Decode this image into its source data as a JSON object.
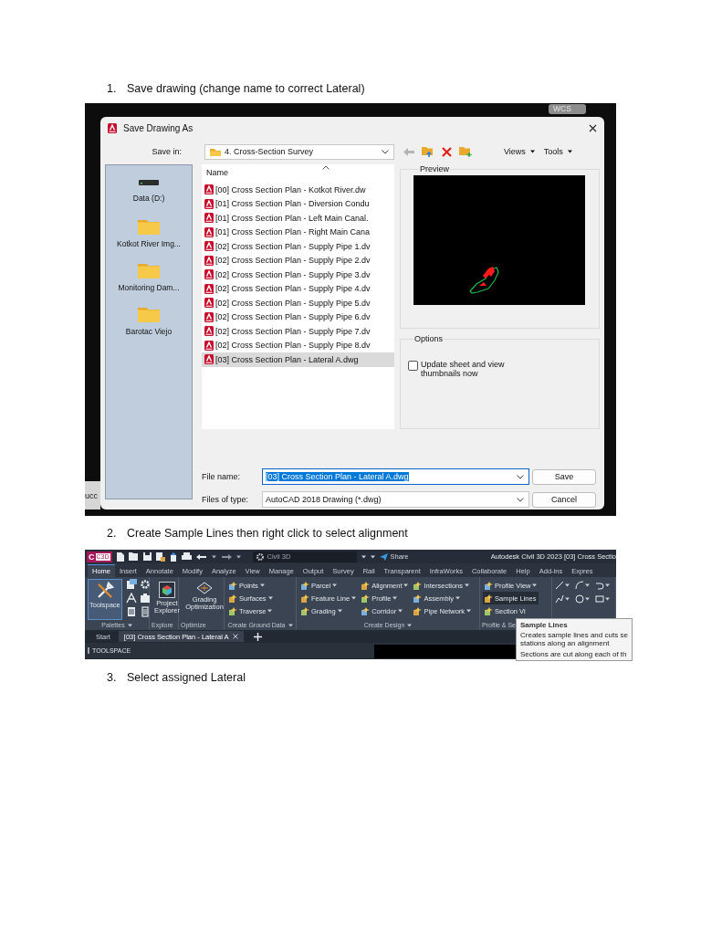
{
  "step_1": {
    "number": "1.",
    "text": "Save drawing (change name to correct Lateral)"
  },
  "save_dialog": {
    "background": {
      "wcs_label": "WCS",
      "edge_text": "ucc"
    },
    "title": "Save Drawing As",
    "save_in": {
      "label": "Save in:",
      "value": "4. Cross-Section Survey"
    },
    "toolbar": [
      {
        "label": "Views"
      },
      {
        "label": "Tools"
      }
    ],
    "places": [
      {
        "kind": "drive",
        "label": "Data (D:)"
      },
      {
        "kind": "folder",
        "label": "Kotkot River Img..."
      },
      {
        "kind": "folder",
        "label": "Monitoring Dam..."
      },
      {
        "kind": "folder",
        "label": "Barotac Viejo"
      }
    ],
    "file_list": {
      "column": "Name",
      "files": [
        {
          "name": "[00] Cross Section Plan - Kotkot River.dw",
          "selected": false
        },
        {
          "name": "[01] Cross Section Plan - Diversion Condu",
          "selected": false
        },
        {
          "name": "[01] Cross Section Plan - Left Main Canal.",
          "selected": false
        },
        {
          "name": "[01] Cross Section Plan - Right Main Cana",
          "selected": false
        },
        {
          "name": "[02] Cross Section Plan - Supply Pipe 1.dv",
          "selected": false
        },
        {
          "name": "[02] Cross Section Plan - Supply Pipe 2.dv",
          "selected": false
        },
        {
          "name": "[02] Cross Section Plan - Supply Pipe 3.dv",
          "selected": false
        },
        {
          "name": "[02] Cross Section Plan - Supply Pipe 4.dv",
          "selected": false
        },
        {
          "name": "[02] Cross Section Plan - Supply Pipe 5.dv",
          "selected": false
        },
        {
          "name": "[02] Cross Section Plan - Supply Pipe 6.dv",
          "selected": false
        },
        {
          "name": "[02] Cross Section Plan - Supply Pipe 7.dv",
          "selected": false
        },
        {
          "name": "[02] Cross Section Plan - Supply Pipe 8.dv",
          "selected": false
        },
        {
          "name": "[03] Cross Section Plan - Lateral A.dwg",
          "selected": true
        }
      ]
    },
    "preview": {
      "label": "Preview"
    },
    "options": {
      "label": "Options",
      "checkbox": {
        "label": "Update sheet and view thumbnails now",
        "checked": false
      }
    },
    "file_name": {
      "label": "File name:",
      "value": "[03] Cross Section Plan - Lateral A.dwg"
    },
    "file_type": {
      "label": "Files of type:",
      "value": "AutoCAD 2018 Drawing (*.dwg)"
    },
    "buttons": [
      {
        "label": "Save"
      },
      {
        "label": "Cancel"
      }
    ]
  },
  "step_2": {
    "number": "2.",
    "text": "Create Sample Lines then right click to select alignment"
  },
  "ribbon": {
    "logo": {
      "letter": "C",
      "tag": "C3D"
    },
    "workspace": "Civil 3D",
    "share": "Share",
    "title": "Autodesk Civil 3D 2023   [03] Cross Sectio",
    "tabs": [
      {
        "label": "Home",
        "selected": true
      },
      {
        "label": "Insert",
        "selected": false
      },
      {
        "label": "Annotate",
        "selected": false
      },
      {
        "label": "Modify",
        "selected": false
      },
      {
        "label": "Analyze",
        "selected": false
      },
      {
        "label": "View",
        "selected": false
      },
      {
        "label": "Manage",
        "selected": false
      },
      {
        "label": "Output",
        "selected": false
      },
      {
        "label": "Survey",
        "selected": false
      },
      {
        "label": "Rail",
        "selected": false
      },
      {
        "label": "Transparent",
        "selected": false
      },
      {
        "label": "InfraWorks",
        "selected": false
      },
      {
        "label": "Collaborate",
        "selected": false
      },
      {
        "label": "Help",
        "selected": false
      },
      {
        "label": "Add-ins",
        "selected": false
      },
      {
        "label": "Expres",
        "selected": false
      }
    ],
    "panels": [
      {
        "kind": "palettes",
        "title": "Palettes",
        "menu": true,
        "tool": {
          "label": "Toolspace",
          "highlighted": true
        }
      },
      {
        "kind": "large",
        "title": "Explore",
        "menu": false,
        "tool": {
          "label": "Project Explorer",
          "highlighted": false
        }
      },
      {
        "kind": "large",
        "title": "Optimize",
        "menu": false,
        "tool": {
          "label": "Grading Optimization",
          "highlighted": false
        }
      },
      {
        "kind": "list",
        "title": "Create Ground Data",
        "menu": true,
        "columns": [
          [
            {
              "label": "Points",
              "dropdown": true,
              "highlighted": false
            },
            {
              "label": "Surfaces",
              "dropdown": true,
              "highlighted": false
            },
            {
              "label": "Traverse",
              "dropdown": true,
              "highlighted": false
            }
          ]
        ]
      },
      {
        "kind": "list",
        "title": "Create Design",
        "menu": true,
        "columns": [
          [
            {
              "label": "Parcel",
              "dropdown": true,
              "highlighted": false
            },
            {
              "label": "Feature Line",
              "dropdown": true,
              "highlighted": false
            },
            {
              "label": "Grading",
              "dropdown": true,
              "highlighted": false
            }
          ],
          [
            {
              "label": "Alignment",
              "dropdown": true,
              "highlighted": false
            },
            {
              "label": "Profile",
              "dropdown": true,
              "highlighted": false
            },
            {
              "label": "Corridor",
              "dropdown": true,
              "highlighted": false
            }
          ],
          [
            {
              "label": "Intersections",
              "dropdown": true,
              "highlighted": false
            },
            {
              "label": "Assembly",
              "dropdown": true,
              "highlighted": false
            },
            {
              "label": "Pipe Network",
              "dropdown": true,
              "highlighted": false
            }
          ]
        ]
      },
      {
        "kind": "list",
        "title": "Profile & Se",
        "menu": false,
        "columns": [
          [
            {
              "label": "Profile View",
              "dropdown": true,
              "highlighted": false
            },
            {
              "label": "Sample Lines",
              "dropdown": false,
              "highlighted": true
            },
            {
              "label": "Section Vi",
              "dropdown": false,
              "highlighted": false
            }
          ]
        ]
      },
      {
        "kind": "draw"
      }
    ],
    "tooltip": {
      "title": "Sample Lines",
      "lines": [
        "Creates sample lines and cuts se",
        "stations along an alignment"
      ],
      "note": "Sections are cut along each of th"
    },
    "doc_tabs": [
      {
        "label": "Start",
        "selected": false,
        "closable": false
      },
      {
        "label": "[03] Cross Section Plan - Lateral A",
        "selected": true,
        "closable": true
      }
    ],
    "toolspace": "TOOLSPACE"
  },
  "step_3": {
    "number": "3.",
    "text": "Select assigned Lateral"
  }
}
